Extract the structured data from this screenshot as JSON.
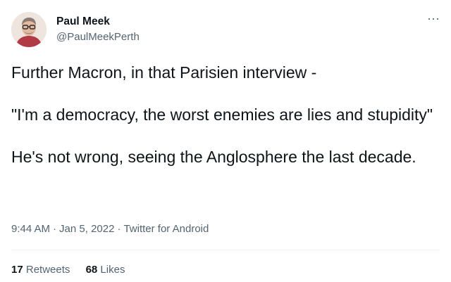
{
  "author": {
    "name": "Paul Meek",
    "handle": "@PaulMeekPerth"
  },
  "menu": {
    "more_icon": "more-horizontal-icon",
    "glyph": "···"
  },
  "tweet": {
    "paragraphs": [
      "Further Macron, in that Parisien interview -",
      "\"I'm a democracy, the worst enemies are lies and stupidity\"",
      "He's not wrong, seeing the Anglosphere the last decade."
    ]
  },
  "meta": {
    "time": "9:44 AM",
    "separator": "·",
    "date": "Jan 5, 2022",
    "source": "Twitter for Android"
  },
  "stats": {
    "retweets_count": "17",
    "retweets_label": "Retweets",
    "likes_count": "68",
    "likes_label": "Likes"
  },
  "colors": {
    "text": "#0f1419",
    "secondary": "#536471",
    "divider": "#eff3f4"
  }
}
